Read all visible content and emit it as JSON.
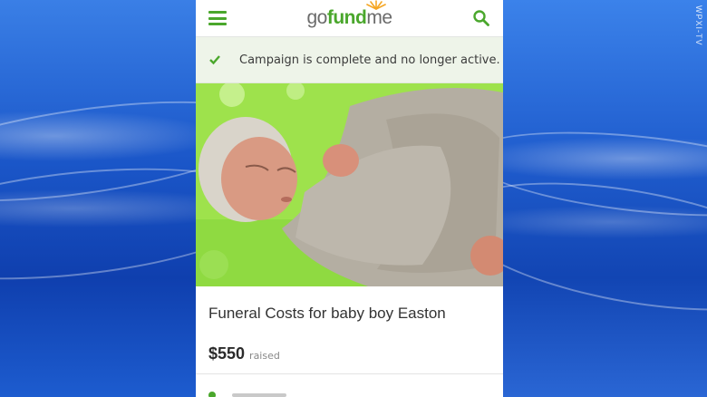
{
  "watermark": "WPXI-TV",
  "header": {
    "logo_go": "go",
    "logo_fund": "fund",
    "logo_me": "me",
    "menu_icon": "hamburger-menu-icon",
    "search_icon": "search-icon"
  },
  "notice": {
    "icon": "check-icon",
    "text": "Campaign is complete and no longer active."
  },
  "campaign": {
    "photo_subject": "newborn baby wrapped in gray blanket",
    "title": "Funeral Costs for baby boy Easton",
    "amount": "$550",
    "amount_label": "raised"
  },
  "colors": {
    "brand_green": "#4aa72c",
    "background_blue": "#1f56c4"
  }
}
